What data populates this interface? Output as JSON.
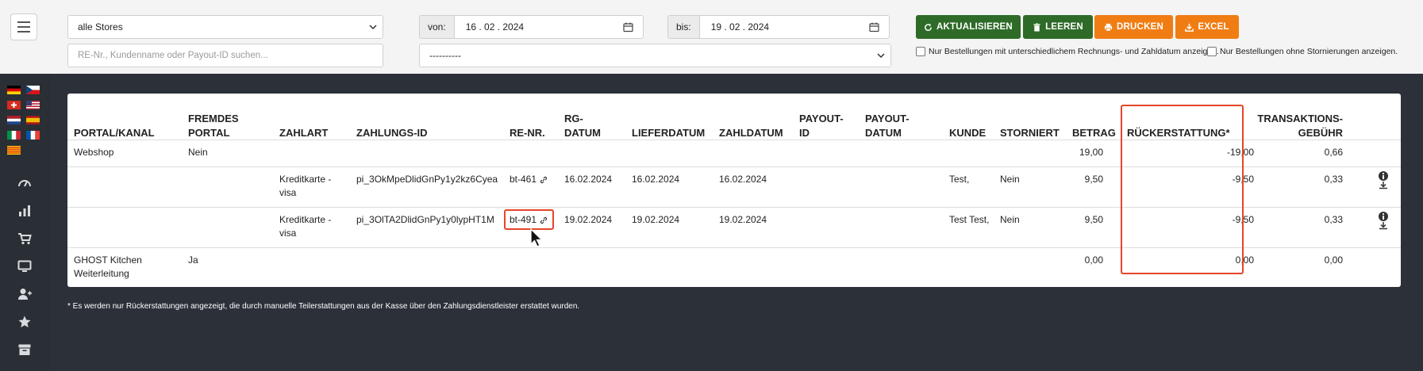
{
  "header": {
    "store_select": "alle Stores",
    "search_placeholder": "RE-Nr., Kundenname oder Payout-ID suchen...",
    "from_label": "von:",
    "from_date": "16 . 02 . 2024",
    "to_label": "bis:",
    "to_date": "19 . 02 . 2024",
    "secondary_select": "----------",
    "buttons": {
      "refresh": "AKTUALISIEREN",
      "clear": "LEEREN",
      "print": "DRUCKEN",
      "excel": "EXCEL"
    },
    "checkbox_1": "Nur Bestellungen mit unterschiedlichem Rechnungs- und Zahldatum anzeigen.",
    "checkbox_2": "Nur Bestellungen ohne Stornierungen anzeigen."
  },
  "table": {
    "headers": {
      "portal": "PORTAL/KANAL",
      "fremdes_1": "FREMDES",
      "fremdes_2": "PORTAL",
      "zahlart": "ZAHLART",
      "zahlungs_id": "ZAHLUNGS-ID",
      "re_nr": "RE-NR.",
      "rg_1": "RG-",
      "rg_2": "DATUM",
      "lieferdatum": "LIEFERDATUM",
      "zahldatum": "ZAHLDATUM",
      "payout_id_1": "PAYOUT-",
      "payout_id_2": "ID",
      "payout_datum_1": "PAYOUT-",
      "payout_datum_2": "DATUM",
      "kunde": "KUNDE",
      "storniert": "STORNIERT",
      "betrag": "BETRAG",
      "rueckerstattung": "RÜCKERSTATTUNG*",
      "gebuehr_1": "TRANSAKTIONS-",
      "gebuehr_2": "GEBÜHR"
    },
    "rows": [
      {
        "portal": "Webshop",
        "fremdes": "Nein",
        "betrag": "19,00",
        "rueckerstattung": "-19,00",
        "gebuehr": "0,66"
      },
      {
        "zahlart_1": "Kreditkarte -",
        "zahlart_2": "visa",
        "zahlungs_id": "pi_3OkMpeDlidGnPy1y2kz6Cyea",
        "re_nr": "bt-461",
        "rg_datum": "16.02.2024",
        "lieferdatum": "16.02.2024",
        "zahldatum": "16.02.2024",
        "kunde": "Test,",
        "storniert": "Nein",
        "betrag": "9,50",
        "rueckerstattung": "-9,50",
        "gebuehr": "0,33"
      },
      {
        "zahlart_1": "Kreditkarte -",
        "zahlart_2": "visa",
        "zahlungs_id": "pi_3OlTA2DlidGnPy1y0lypHT1M",
        "re_nr": "bt-491",
        "rg_datum": "19.02.2024",
        "lieferdatum": "19.02.2024",
        "zahldatum": "19.02.2024",
        "kunde": "Test Test,",
        "storniert": "Nein",
        "betrag": "9,50",
        "rueckerstattung": "-9,50",
        "gebuehr": "0,33"
      },
      {
        "portal_1": "GHOST Kitchen",
        "portal_2": "Weiterleitung",
        "fremdes": "Ja",
        "betrag": "0,00",
        "rueckerstattung": "0,00",
        "gebuehr": "0,00"
      }
    ]
  },
  "footnote": "* Es werden nur Rückerstattungen angezeigt, die durch manuelle Teilerstattungen aus der Kasse über den Zahlungsdienstleister erstattet wurden.",
  "colors": {
    "green_button": "#2e6b28",
    "orange_button": "#f07d13",
    "highlight": "#e5452a",
    "background": "#2b3039"
  },
  "sidebar_icons": [
    "speedometer-icon",
    "bar-chart-icon",
    "cart-icon",
    "monitor-icon",
    "add-user-icon",
    "star-icon",
    "archive-icon"
  ],
  "flags": [
    "de",
    "cz",
    "ch",
    "us",
    "nl",
    "es",
    "it",
    "fr",
    "catalonia"
  ]
}
